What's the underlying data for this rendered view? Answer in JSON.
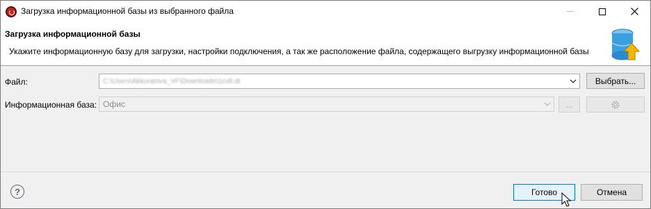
{
  "window": {
    "title": "Загрузка информационной базы из выбранного файла"
  },
  "banner": {
    "title": "Загрузка информационной базы",
    "description": "Укажите информационную базу для загрузки, настройки подключения, а так же расположение файла, содержащего выгрузку информационной базы",
    "icon": "database-upload-icon"
  },
  "form": {
    "file_label": "Файл:",
    "file_value": "C:\\Users\\Akkuratova_VF\\Downloads\\1cv8.dt",
    "choose_label": "Выбрать...",
    "base_label": "Информационная база:",
    "base_value": "Офис",
    "ellipsis_label": "..."
  },
  "footer": {
    "help_symbol": "?",
    "ok_label": "Готово",
    "cancel_label": "Отмена"
  },
  "colors": {
    "accent": "#0078d7",
    "app_icon": "#cc2020",
    "db_icon": "#3aa0e0",
    "arrow": "#f5b400"
  }
}
